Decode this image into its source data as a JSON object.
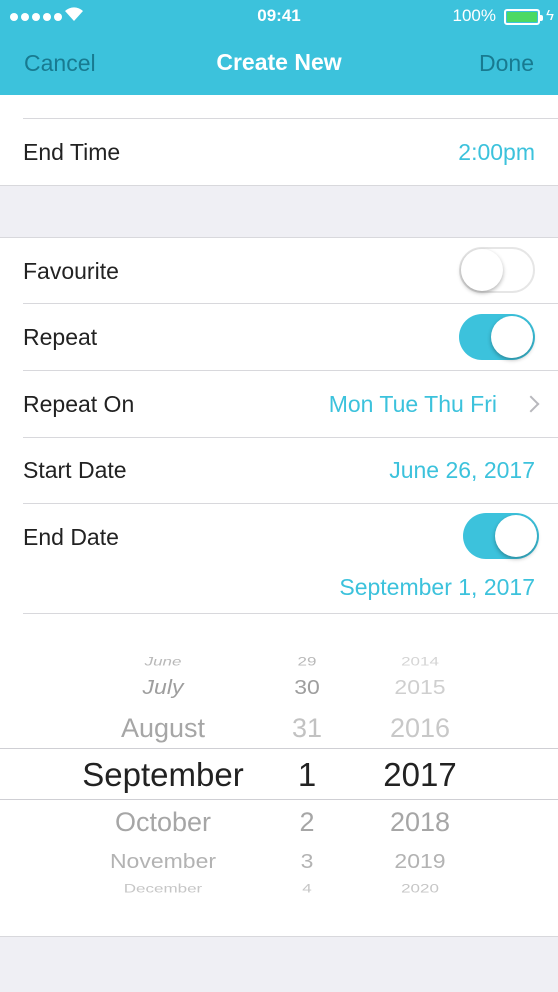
{
  "status_bar": {
    "time": "09:41",
    "battery_percent": "100%"
  },
  "nav": {
    "cancel_label": "Cancel",
    "title": "Create New",
    "done_label": "Done"
  },
  "time_group": {
    "end_time_label": "End Time",
    "end_time_value": "2:00pm"
  },
  "options_group": {
    "favourite_label": "Favourite",
    "favourite_on": false,
    "repeat_label": "Repeat",
    "repeat_on": true,
    "repeat_on_label": "Repeat On",
    "repeat_on_value": "Mon Tue Thu Fri",
    "start_date_label": "Start Date",
    "start_date_value": "June 26, 2017",
    "end_date_label": "End Date",
    "end_date_on": true,
    "end_date_value": "September 1, 2017"
  },
  "date_picker": {
    "months": [
      "June",
      "July",
      "August",
      "September",
      "October",
      "November",
      "December"
    ],
    "days": [
      "29",
      "30",
      "31",
      "1",
      "2",
      "3",
      "4"
    ],
    "years": [
      "2014",
      "2015",
      "2016",
      "2017",
      "2018",
      "2019",
      "2020"
    ],
    "selected": {
      "month": "September",
      "day": "1",
      "year": "2017"
    }
  },
  "colors": {
    "accent": "#3cc2dc",
    "nav_button_text": "#187a90",
    "battery": "#4cd964",
    "background": "#efeff4"
  }
}
